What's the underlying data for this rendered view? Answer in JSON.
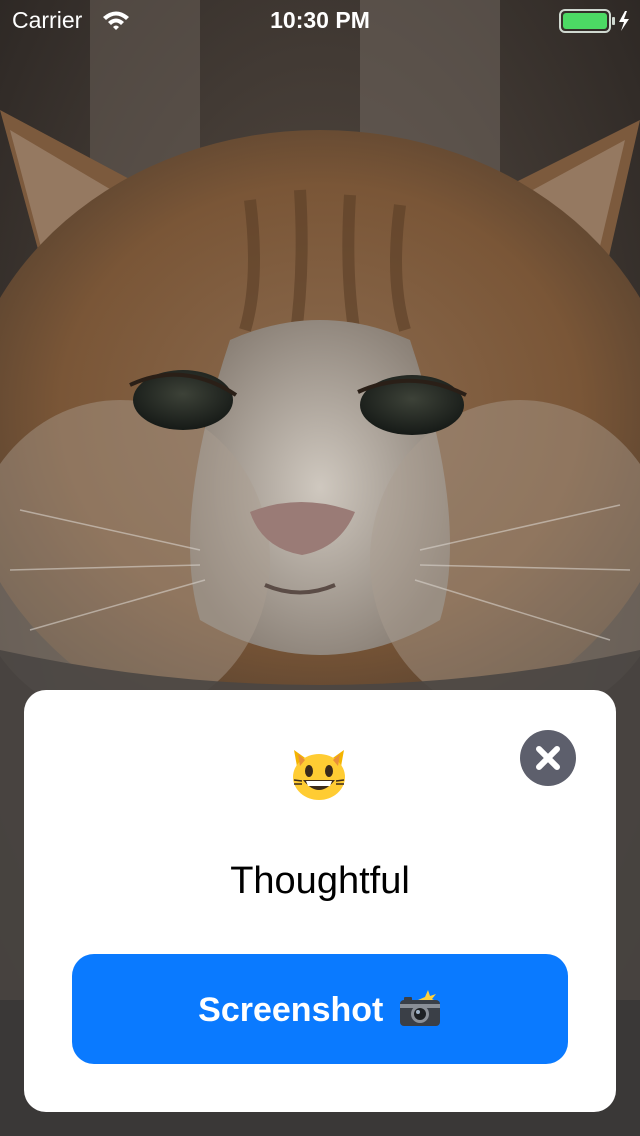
{
  "status_bar": {
    "carrier": "Carrier",
    "time": "10:30 PM",
    "battery_icon": "battery-charging-icon",
    "wifi_icon": "wifi-icon"
  },
  "background": {
    "icon": "cat-photo"
  },
  "card": {
    "emoji_icon": "grinning-cat-emoji",
    "mood": "Thoughtful",
    "close_icon": "close-icon",
    "screenshot_label": "Screenshot",
    "camera_icon": "camera-flash-icon"
  },
  "colors": {
    "button_blue": "#0a7aff",
    "close_gray": "#5d5f6c",
    "battery_green": "#4cd964"
  }
}
